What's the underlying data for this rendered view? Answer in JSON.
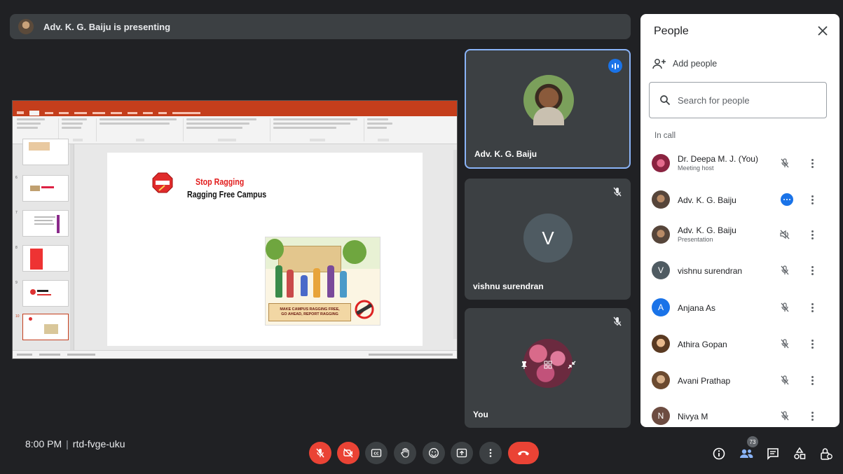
{
  "banner": {
    "text": "Adv. K. G. Baiju is presenting"
  },
  "slide": {
    "title": "Stop Ragging",
    "subtitle": "Ragging Free Campus",
    "caption_line1": "MAKE CAMPUS RAGGING FREE,",
    "caption_line2": "GO AHEAD, REPORT RAGGING",
    "thumb_numbers": [
      "6",
      "7",
      "8",
      "9",
      "10"
    ]
  },
  "tiles": [
    {
      "name": "Adv. K. G. Baiju"
    },
    {
      "name": "vishnu surendran",
      "initial": "V"
    },
    {
      "name": "You"
    }
  ],
  "meeting": {
    "time": "8:00 PM",
    "code": "rtd-fvge-uku"
  },
  "people_count": "73",
  "panel": {
    "title": "People",
    "add_people": "Add people",
    "search_placeholder": "Search for people",
    "in_call": "In call",
    "participants": [
      {
        "name": "Dr. Deepa M. J. (You)",
        "sub": "Meeting host"
      },
      {
        "name": "Adv. K. G. Baiju"
      },
      {
        "name": "Adv. K. G. Baiju",
        "sub": "Presentation"
      },
      {
        "name": "vishnu surendran",
        "initial": "V"
      },
      {
        "name": "Anjana As",
        "initial": "A"
      },
      {
        "name": "Athira Gopan"
      },
      {
        "name": "Avani Prathap"
      },
      {
        "name": "Nivya M",
        "initial": "N"
      }
    ]
  },
  "colors": {
    "end_call": "#ea4335",
    "accent": "#1a73e8",
    "tile_bg": "#3c4043",
    "ppt": "#c43e1c"
  }
}
